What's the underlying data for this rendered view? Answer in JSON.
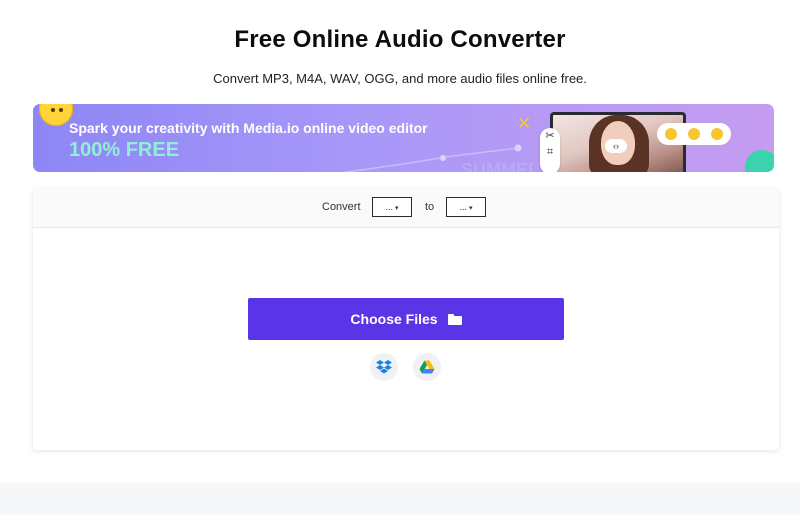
{
  "header": {
    "title": "Free Online Audio Converter",
    "subtitle": "Convert MP3, M4A, WAV, OGG, and more audio files online free."
  },
  "banner": {
    "headline": "Spark your creativity with Media.io online video editor",
    "tagline": "100% FREE",
    "deco_text": "SUMMER",
    "colors": {
      "gradient_start": "#8e86f6",
      "gradient_end": "#c49cf0",
      "tagline": "#8ff0d8"
    }
  },
  "converter": {
    "convert_label": "Convert",
    "to_label": "to",
    "from_select_value": "...",
    "to_select_value": "...",
    "choose_files_label": "Choose Files",
    "cloud_sources": [
      "dropbox-icon",
      "google-drive-icon"
    ],
    "accent_color": "#5a35e8"
  }
}
